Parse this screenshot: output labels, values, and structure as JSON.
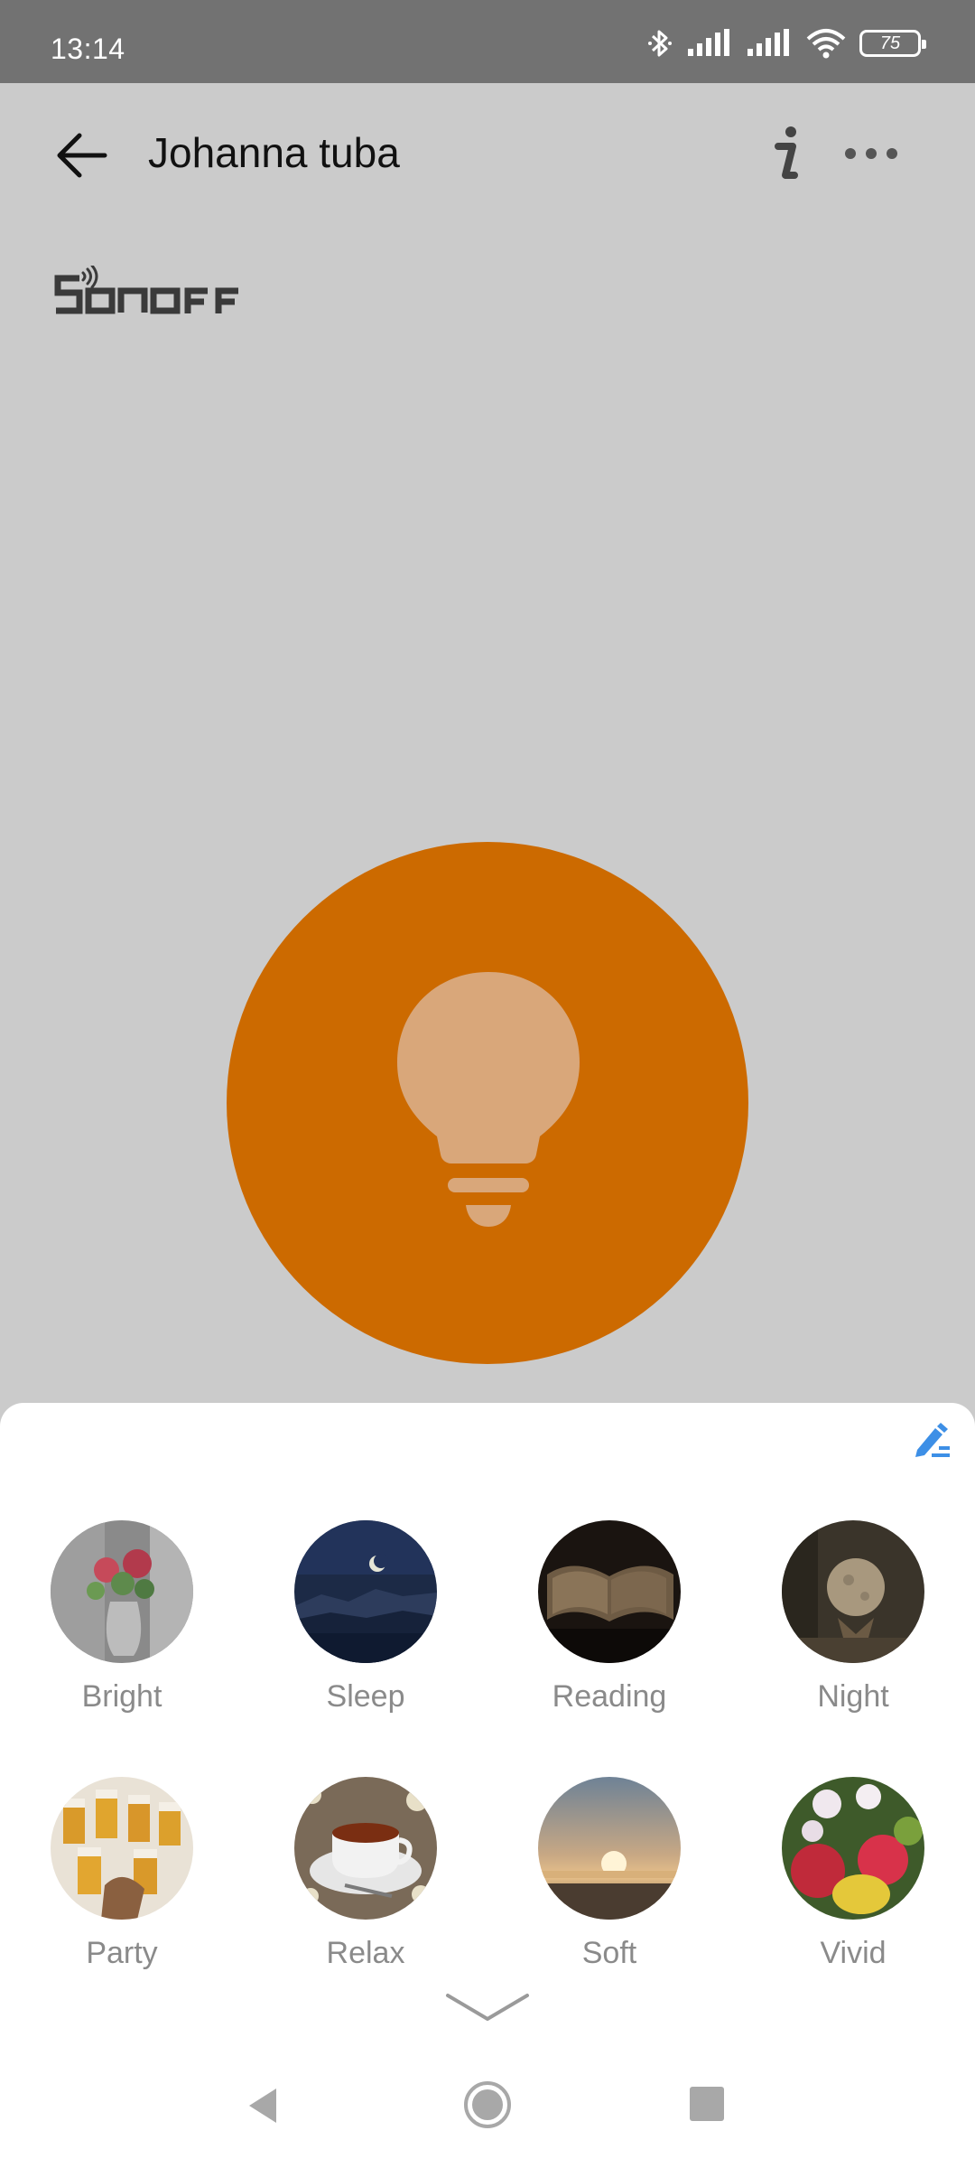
{
  "status_bar": {
    "time": "13:14",
    "battery": "75"
  },
  "header": {
    "title": "Johanna tuba",
    "back_icon": "arrow-left-icon",
    "info_icon": "info-icon",
    "more_icon": "more-horizontal-icon"
  },
  "brand": {
    "logo_text": "SONOFF"
  },
  "power": {
    "icon": "light-bulb-icon",
    "color": "#cc6a00"
  },
  "scenes": {
    "edit_icon": "edit-pencil-icon",
    "items": [
      {
        "label": "Bright"
      },
      {
        "label": "Sleep"
      },
      {
        "label": "Reading"
      },
      {
        "label": "Night"
      },
      {
        "label": "Party"
      },
      {
        "label": "Relax"
      },
      {
        "label": "Soft"
      },
      {
        "label": "Vivid"
      }
    ],
    "collapse_icon": "chevron-down-icon"
  },
  "colors": {
    "accent": "#cc6a00",
    "edit_icon": "#3d8fe6",
    "label": "#8a8a8a"
  }
}
